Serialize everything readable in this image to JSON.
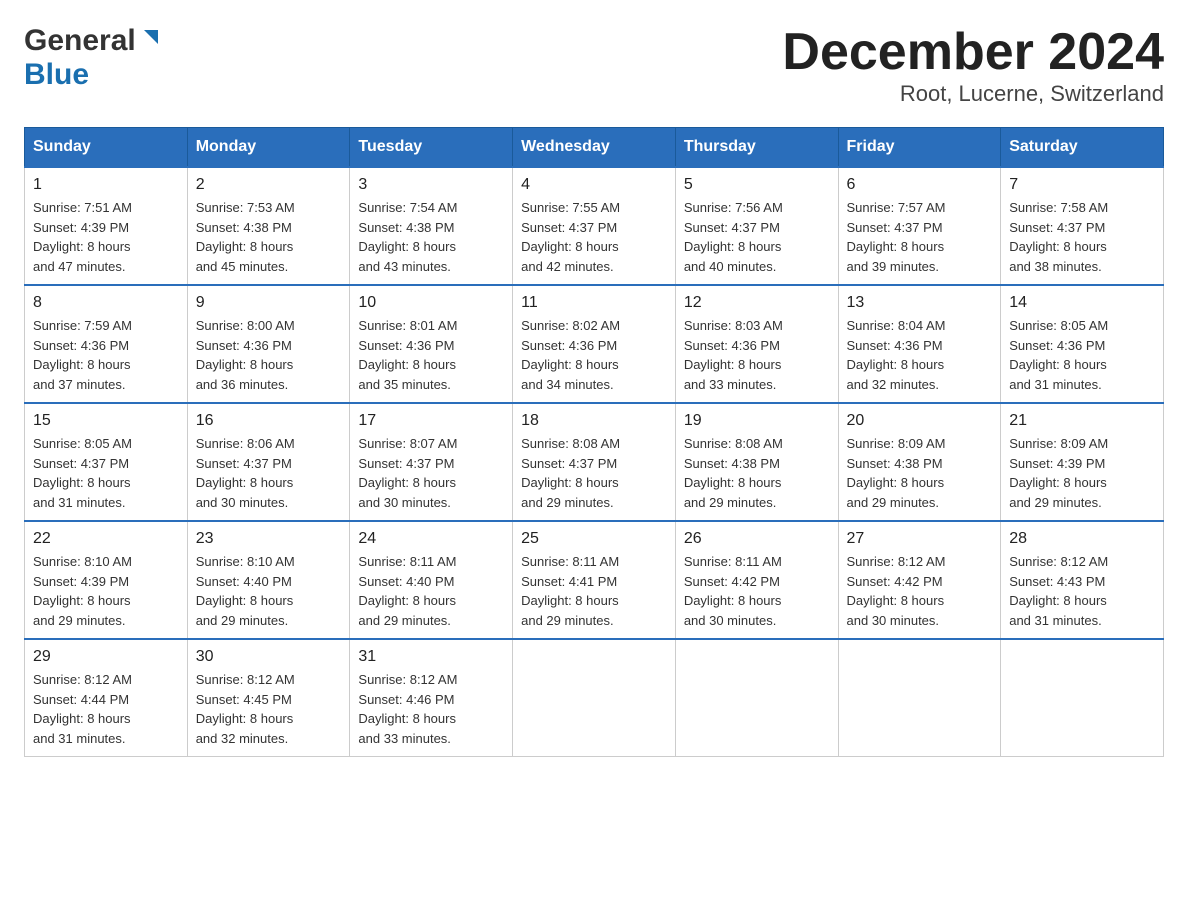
{
  "logo": {
    "general": "General",
    "blue": "Blue"
  },
  "title": "December 2024",
  "subtitle": "Root, Lucerne, Switzerland",
  "days_of_week": [
    "Sunday",
    "Monday",
    "Tuesday",
    "Wednesday",
    "Thursday",
    "Friday",
    "Saturday"
  ],
  "weeks": [
    [
      {
        "day": "1",
        "sunrise": "7:51 AM",
        "sunset": "4:39 PM",
        "daylight": "8 hours and 47 minutes."
      },
      {
        "day": "2",
        "sunrise": "7:53 AM",
        "sunset": "4:38 PM",
        "daylight": "8 hours and 45 minutes."
      },
      {
        "day": "3",
        "sunrise": "7:54 AM",
        "sunset": "4:38 PM",
        "daylight": "8 hours and 43 minutes."
      },
      {
        "day": "4",
        "sunrise": "7:55 AM",
        "sunset": "4:37 PM",
        "daylight": "8 hours and 42 minutes."
      },
      {
        "day": "5",
        "sunrise": "7:56 AM",
        "sunset": "4:37 PM",
        "daylight": "8 hours and 40 minutes."
      },
      {
        "day": "6",
        "sunrise": "7:57 AM",
        "sunset": "4:37 PM",
        "daylight": "8 hours and 39 minutes."
      },
      {
        "day": "7",
        "sunrise": "7:58 AM",
        "sunset": "4:37 PM",
        "daylight": "8 hours and 38 minutes."
      }
    ],
    [
      {
        "day": "8",
        "sunrise": "7:59 AM",
        "sunset": "4:36 PM",
        "daylight": "8 hours and 37 minutes."
      },
      {
        "day": "9",
        "sunrise": "8:00 AM",
        "sunset": "4:36 PM",
        "daylight": "8 hours and 36 minutes."
      },
      {
        "day": "10",
        "sunrise": "8:01 AM",
        "sunset": "4:36 PM",
        "daylight": "8 hours and 35 minutes."
      },
      {
        "day": "11",
        "sunrise": "8:02 AM",
        "sunset": "4:36 PM",
        "daylight": "8 hours and 34 minutes."
      },
      {
        "day": "12",
        "sunrise": "8:03 AM",
        "sunset": "4:36 PM",
        "daylight": "8 hours and 33 minutes."
      },
      {
        "day": "13",
        "sunrise": "8:04 AM",
        "sunset": "4:36 PM",
        "daylight": "8 hours and 32 minutes."
      },
      {
        "day": "14",
        "sunrise": "8:05 AM",
        "sunset": "4:36 PM",
        "daylight": "8 hours and 31 minutes."
      }
    ],
    [
      {
        "day": "15",
        "sunrise": "8:05 AM",
        "sunset": "4:37 PM",
        "daylight": "8 hours and 31 minutes."
      },
      {
        "day": "16",
        "sunrise": "8:06 AM",
        "sunset": "4:37 PM",
        "daylight": "8 hours and 30 minutes."
      },
      {
        "day": "17",
        "sunrise": "8:07 AM",
        "sunset": "4:37 PM",
        "daylight": "8 hours and 30 minutes."
      },
      {
        "day": "18",
        "sunrise": "8:08 AM",
        "sunset": "4:37 PM",
        "daylight": "8 hours and 29 minutes."
      },
      {
        "day": "19",
        "sunrise": "8:08 AM",
        "sunset": "4:38 PM",
        "daylight": "8 hours and 29 minutes."
      },
      {
        "day": "20",
        "sunrise": "8:09 AM",
        "sunset": "4:38 PM",
        "daylight": "8 hours and 29 minutes."
      },
      {
        "day": "21",
        "sunrise": "8:09 AM",
        "sunset": "4:39 PM",
        "daylight": "8 hours and 29 minutes."
      }
    ],
    [
      {
        "day": "22",
        "sunrise": "8:10 AM",
        "sunset": "4:39 PM",
        "daylight": "8 hours and 29 minutes."
      },
      {
        "day": "23",
        "sunrise": "8:10 AM",
        "sunset": "4:40 PM",
        "daylight": "8 hours and 29 minutes."
      },
      {
        "day": "24",
        "sunrise": "8:11 AM",
        "sunset": "4:40 PM",
        "daylight": "8 hours and 29 minutes."
      },
      {
        "day": "25",
        "sunrise": "8:11 AM",
        "sunset": "4:41 PM",
        "daylight": "8 hours and 29 minutes."
      },
      {
        "day": "26",
        "sunrise": "8:11 AM",
        "sunset": "4:42 PM",
        "daylight": "8 hours and 30 minutes."
      },
      {
        "day": "27",
        "sunrise": "8:12 AM",
        "sunset": "4:42 PM",
        "daylight": "8 hours and 30 minutes."
      },
      {
        "day": "28",
        "sunrise": "8:12 AM",
        "sunset": "4:43 PM",
        "daylight": "8 hours and 31 minutes."
      }
    ],
    [
      {
        "day": "29",
        "sunrise": "8:12 AM",
        "sunset": "4:44 PM",
        "daylight": "8 hours and 31 minutes."
      },
      {
        "day": "30",
        "sunrise": "8:12 AM",
        "sunset": "4:45 PM",
        "daylight": "8 hours and 32 minutes."
      },
      {
        "day": "31",
        "sunrise": "8:12 AM",
        "sunset": "4:46 PM",
        "daylight": "8 hours and 33 minutes."
      },
      null,
      null,
      null,
      null
    ]
  ],
  "labels": {
    "sunrise": "Sunrise:",
    "sunset": "Sunset:",
    "daylight": "Daylight:"
  }
}
